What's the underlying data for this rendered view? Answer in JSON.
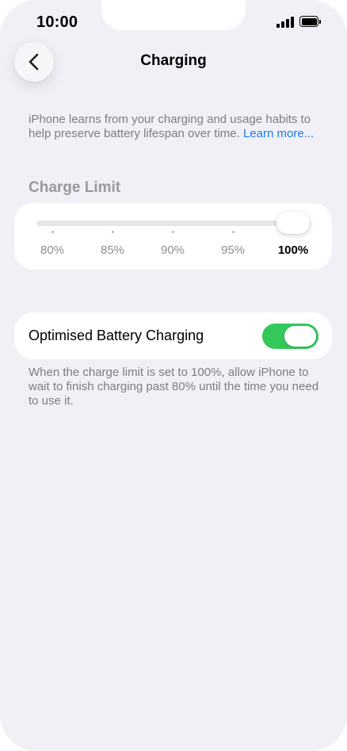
{
  "status_bar": {
    "time": "10:00",
    "signal_icon": "cellular-signal-icon",
    "battery_icon": "battery-full-icon"
  },
  "nav": {
    "title": "Charging",
    "back_icon": "chevron-left-icon"
  },
  "intro": {
    "text": "iPhone learns from your charging and usage habits to help preserve battery lifespan over time. ",
    "link": "Learn more..."
  },
  "charge_limit": {
    "header": "Charge Limit",
    "options": [
      "80%",
      "85%",
      "90%",
      "95%",
      "100%"
    ],
    "selected": "100%",
    "selected_index": 4
  },
  "optimised": {
    "label": "Optimised Battery Charging",
    "enabled": true,
    "footer": "When the charge limit is set to 100%, allow iPhone to wait to finish charging past 80% until the time you need to use it."
  },
  "colors": {
    "background": "#f1f0f6",
    "card": "#ffffff",
    "link": "#1a7bf0",
    "toggle_on": "#34c759",
    "secondary_text": "#7d7d82"
  }
}
